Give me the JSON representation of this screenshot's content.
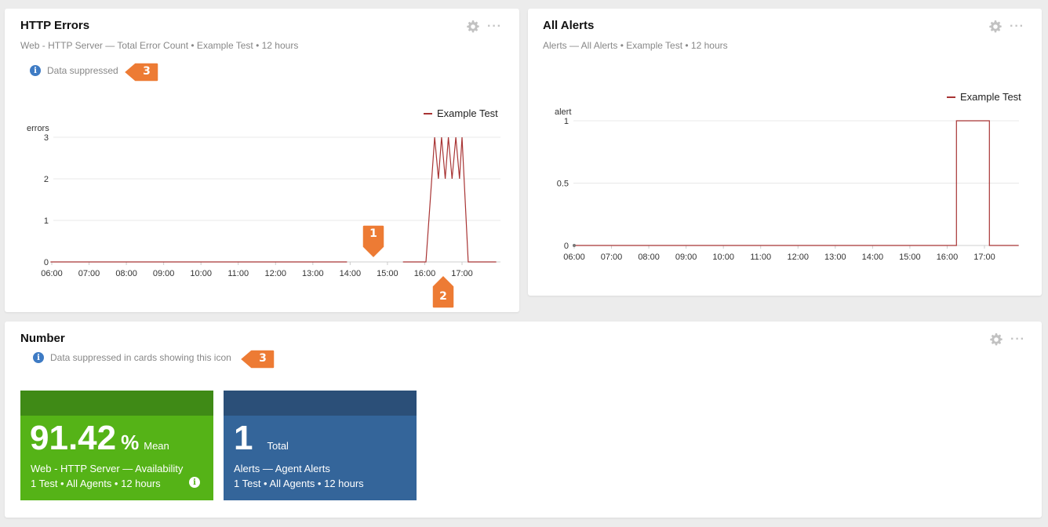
{
  "http_errors": {
    "title": "HTTP Errors",
    "subtitle": "Web - HTTP Server — Total Error Count • Example Test • 12 hours",
    "suppressed_label": "Data suppressed",
    "callouts": [
      "1",
      "2",
      "3"
    ]
  },
  "all_alerts": {
    "title": "All Alerts",
    "subtitle": "Alerts — All Alerts • Example Test • 12 hours"
  },
  "number": {
    "title": "Number",
    "suppressed_label": "Data suppressed in cards showing this icon",
    "callout": "3",
    "tiles": [
      {
        "value": "91.42",
        "unit": "%",
        "stat": "Mean",
        "line1": "Web - HTTP Server — Availability",
        "line2": "1 Test • All Agents • 12 hours",
        "head_color": "#3f8a16",
        "body_color": "#55b317"
      },
      {
        "value": "1",
        "unit": "",
        "stat": "Total",
        "line1": "Alerts — Agent Alerts",
        "line2": "1 Test • All Agents • 12 hours",
        "head_color": "#2b4f78",
        "body_color": "#34659a"
      }
    ]
  },
  "chart_data": [
    {
      "type": "line",
      "ylabel": "errors",
      "ylim": [
        0,
        3
      ],
      "yticks": [
        "0",
        "1",
        "2",
        "3"
      ],
      "xticks": [
        "06:00",
        "07:00",
        "08:00",
        "09:00",
        "10:00",
        "11:00",
        "12:00",
        "13:00",
        "14:00",
        "15:00",
        "16:00",
        "17:00"
      ],
      "series": [
        {
          "name": "Example Test",
          "color": "#a83434",
          "segments": [
            [
              [
                "05:58",
                0
              ],
              [
                "13:55",
                0
              ]
            ],
            [
              [
                "15:25",
                0
              ],
              [
                "16:02",
                0
              ],
              [
                "16:16",
                3
              ],
              [
                "16:22",
                2
              ],
              [
                "16:27",
                3
              ],
              [
                "16:33",
                2
              ],
              [
                "16:38",
                3
              ],
              [
                "16:44",
                2
              ],
              [
                "16:50",
                3
              ],
              [
                "16:56",
                2
              ],
              [
                "17:00",
                3
              ],
              [
                "17:10",
                0
              ],
              [
                "17:55",
                0
              ]
            ]
          ]
        }
      ],
      "legend": "top-right",
      "grid": true
    },
    {
      "type": "line",
      "ylabel": "alert",
      "ylim": [
        0,
        1
      ],
      "yticks": [
        "0",
        "0.5",
        "1"
      ],
      "xticks": [
        "06:00",
        "07:00",
        "08:00",
        "09:00",
        "10:00",
        "11:00",
        "12:00",
        "13:00",
        "14:00",
        "15:00",
        "16:00",
        "17:00"
      ],
      "series": [
        {
          "name": "Example Test",
          "color": "#a83434",
          "segments": [
            [
              [
                "06:00",
                0
              ],
              [
                "16:15",
                0
              ],
              [
                "16:15",
                1
              ],
              [
                "17:08",
                1
              ],
              [
                "17:08",
                0
              ],
              [
                "17:55",
                0
              ]
            ]
          ]
        }
      ],
      "legend": "top-right",
      "grid": true
    }
  ]
}
